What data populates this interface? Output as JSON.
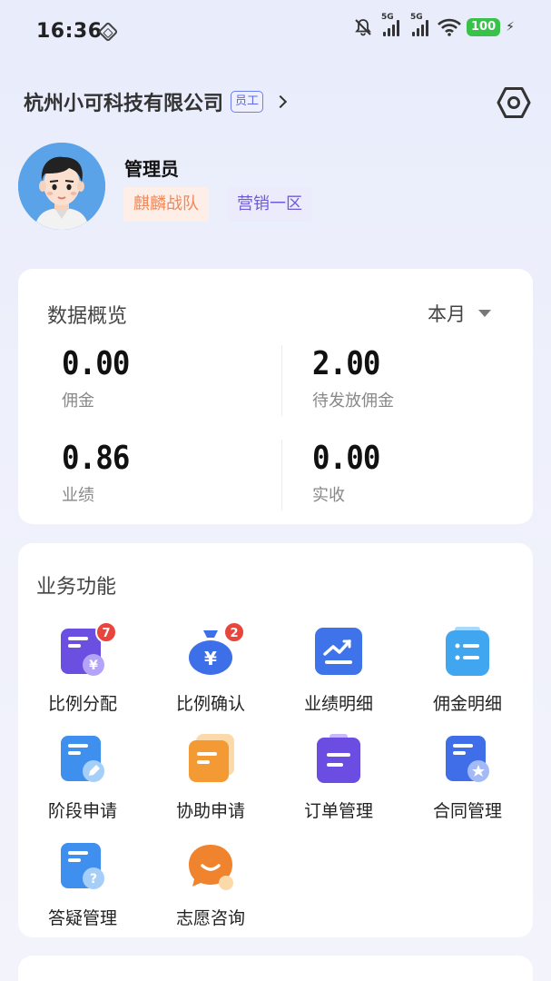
{
  "status_bar": {
    "time": "16:36",
    "sim1_label": "5G",
    "sim2_label": "5G",
    "battery": "100"
  },
  "header": {
    "company": "杭州小可科技有限公司",
    "role_badge": "员工"
  },
  "profile": {
    "name": "管理员",
    "team_tag": "麒麟战队",
    "area_tag": "营销一区"
  },
  "overview": {
    "title": "数据概览",
    "period": "本月",
    "metrics": [
      {
        "value": "0.00",
        "label": "佣金"
      },
      {
        "value": "2.00",
        "label": "待发放佣金"
      },
      {
        "value": "0.86",
        "label": "业绩"
      },
      {
        "value": "0.00",
        "label": "实收"
      }
    ]
  },
  "functions": {
    "title": "业务功能",
    "items": [
      {
        "label": "比例分配",
        "icon": "ratio-allocate-icon",
        "badge": "7"
      },
      {
        "label": "比例确认",
        "icon": "ratio-confirm-icon",
        "badge": "2"
      },
      {
        "label": "业绩明细",
        "icon": "performance-chart-icon"
      },
      {
        "label": "佣金明细",
        "icon": "commission-list-icon"
      },
      {
        "label": "阶段申请",
        "icon": "stage-apply-icon"
      },
      {
        "label": "协助申请",
        "icon": "assist-apply-icon"
      },
      {
        "label": "订单管理",
        "icon": "order-manage-icon"
      },
      {
        "label": "合同管理",
        "icon": "contract-manage-icon"
      },
      {
        "label": "答疑管理",
        "icon": "qa-manage-icon"
      },
      {
        "label": "志愿咨询",
        "icon": "consult-chat-icon"
      }
    ]
  },
  "colors": {
    "accent": "#5a6ae8",
    "badge": "#e8453c",
    "team_tag": "#f0885a",
    "area_tag": "#6c5bd8",
    "battery": "#39c24a"
  }
}
